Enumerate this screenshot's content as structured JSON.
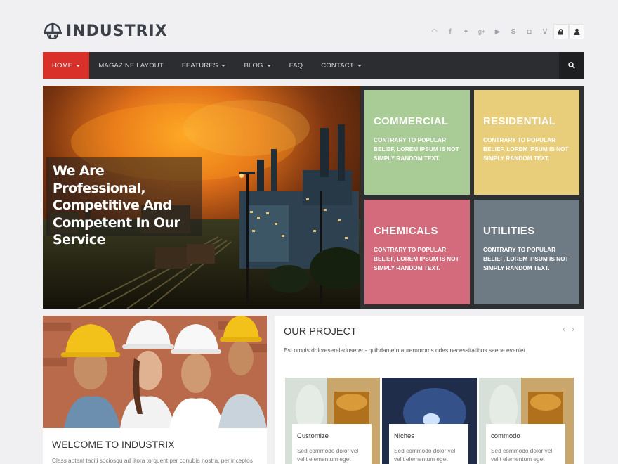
{
  "header": {
    "logo_text": "INDUSTRIX",
    "social_icons": [
      "rss-icon",
      "facebook-icon",
      "twitter-icon",
      "google-plus-icon",
      "youtube-icon",
      "skype-icon",
      "flickr-icon",
      "vimeo-icon",
      "lock-icon",
      "user-icon"
    ]
  },
  "nav": {
    "items": [
      {
        "label": "HOME",
        "has_caret": true,
        "active": true
      },
      {
        "label": "MAGAZINE LAYOUT",
        "has_caret": false,
        "active": false
      },
      {
        "label": "FEATURES",
        "has_caret": true,
        "active": false
      },
      {
        "label": "BLOG",
        "has_caret": true,
        "active": false
      },
      {
        "label": "FAQ",
        "has_caret": false,
        "active": false
      },
      {
        "label": "CONTACT",
        "has_caret": true,
        "active": false
      }
    ],
    "search_icon": "search-icon",
    "accent_color": "#d9302a"
  },
  "hero": {
    "caption": "We Are Professional, Competitive And Competent In Our Service"
  },
  "tiles": [
    {
      "title": "COMMERCIAL",
      "text": "CONTRARY TO POPULAR BELIEF, LOREM IPSUM IS NOT SIMPLY RANDOM TEXT.",
      "color": "#a9cc97"
    },
    {
      "title": "RESIDENTIAL",
      "text": "CONTRARY TO POPULAR BELIEF, LOREM IPSUM IS NOT SIMPLY RANDOM TEXT.",
      "color": "#e8cd7b"
    },
    {
      "title": "CHEMICALS",
      "text": "CONTRARY TO POPULAR BELIEF, LOREM IPSUM IS NOT SIMPLY RANDOM TEXT.",
      "color": "#d46b7c"
    },
    {
      "title": "UTILITIES",
      "text": "CONTRARY TO POPULAR BELIEF, LOREM IPSUM IS NOT SIMPLY RANDOM TEXT.",
      "color": "#6f7b84"
    }
  ],
  "welcome": {
    "title": "WELCOME TO INDUSTRIX",
    "text": "Class aptent taciti sociosqu ad litora torquent per conubia nostra, per inceptos"
  },
  "project": {
    "title": "OUR PROJECT",
    "description": "Est omnis doloresereleduserep- quibdameto aurerumoms odes necessitatibus saepe eveniet",
    "cards": [
      {
        "title": "Customize",
        "text": "Sed commodo dolor vel velit elementum eget"
      },
      {
        "title": "Niches",
        "text": "Sed commodo dolor vel velit elementum eget"
      },
      {
        "title": "commodo",
        "text": "Sed commodo dolor vel velit elementum eget"
      }
    ]
  }
}
